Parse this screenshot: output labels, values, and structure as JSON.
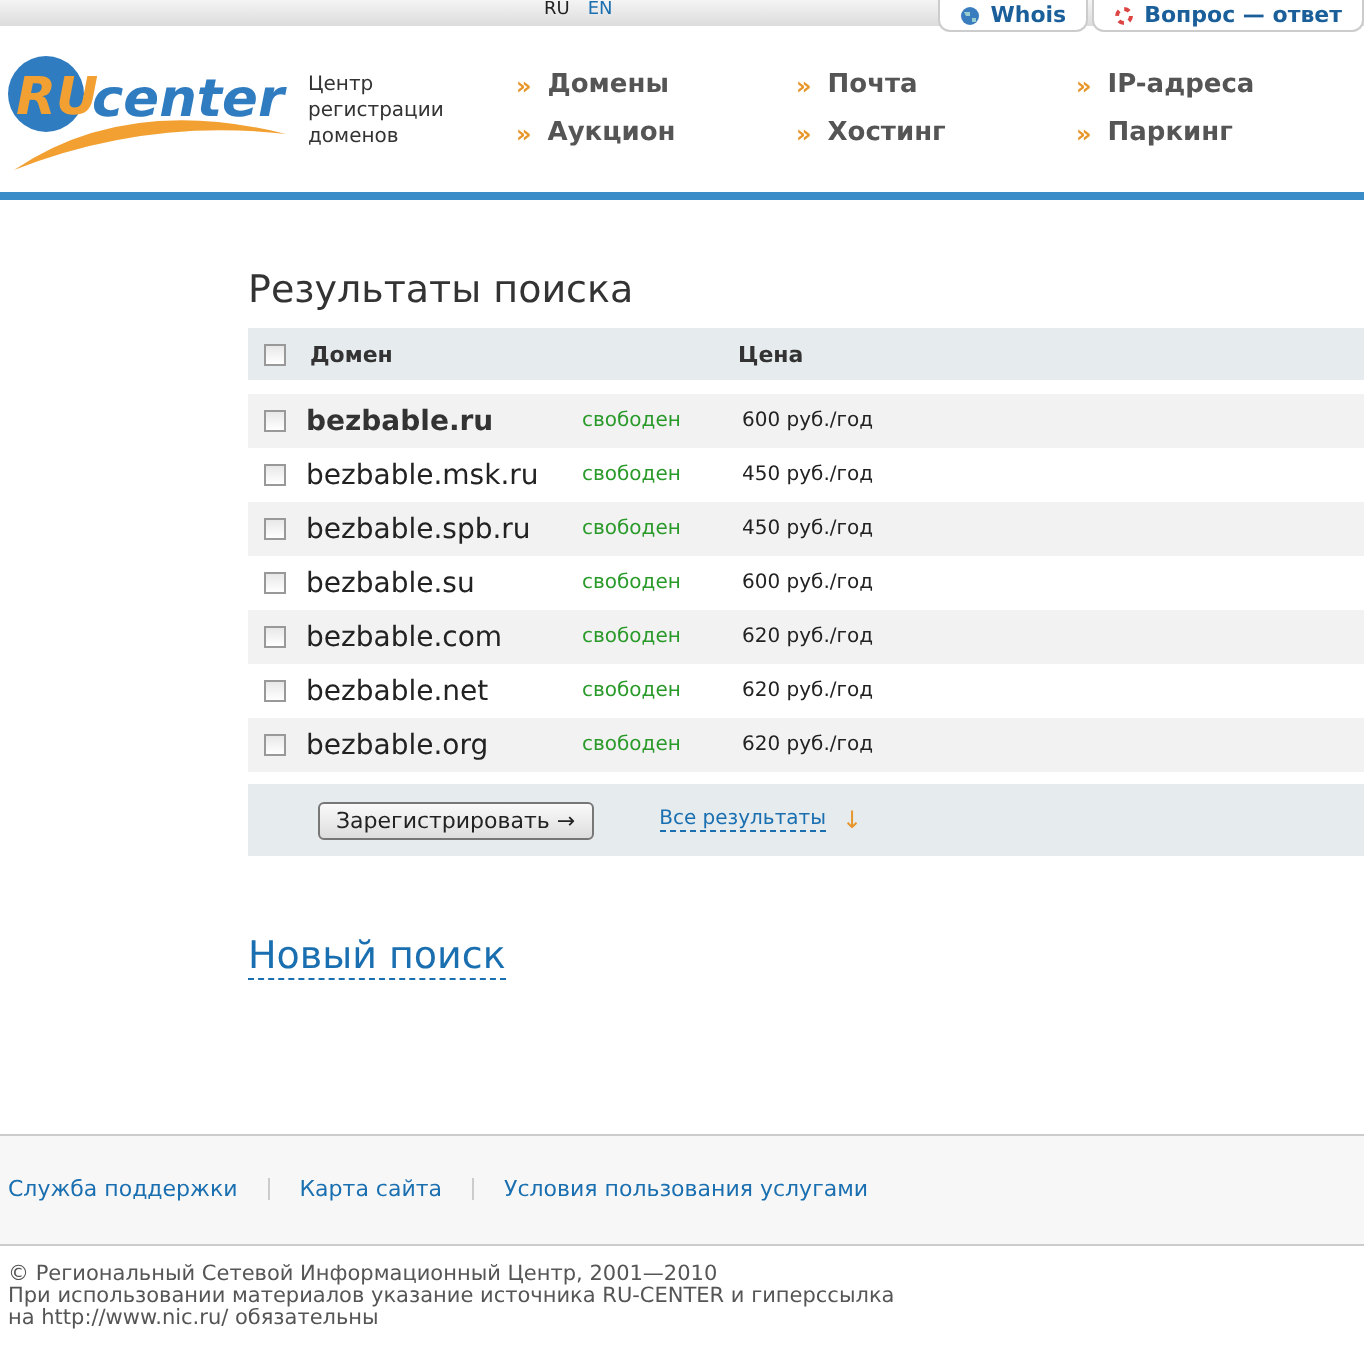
{
  "languages": [
    {
      "label": "RU",
      "selected": true
    },
    {
      "label": "EN",
      "selected": false
    }
  ],
  "top_tabs": [
    "Whois",
    "Вопрос — ответ"
  ],
  "logo": {
    "mark": "RU",
    "word": "center"
  },
  "tagline": [
    "Центр",
    "регистрации",
    "доменов"
  ],
  "nav": [
    {
      "marker": "»",
      "label": "Домены"
    },
    {
      "marker": "»",
      "label": "Почта"
    },
    {
      "marker": "»",
      "label": "IP-адреса"
    },
    {
      "marker": "»",
      "label": "Аукцион"
    },
    {
      "marker": "»",
      "label": "Хостинг"
    },
    {
      "marker": "»",
      "label": "Паркинг"
    }
  ],
  "title": "Результаты поиска",
  "table": {
    "columns": [
      "Домен",
      "Цена"
    ],
    "select_all": false,
    "rows": [
      {
        "domain": "bezbable.ru",
        "emphasized": true,
        "status": "свободен",
        "price": "600 руб./год",
        "checked": false
      },
      {
        "domain": "bezbable.msk.ru",
        "emphasized": false,
        "status": "свободен",
        "price": "450 руб./год",
        "checked": false
      },
      {
        "domain": "bezbable.spb.ru",
        "emphasized": false,
        "status": "свободен",
        "price": "450 руб./год",
        "checked": false
      },
      {
        "domain": "bezbable.su",
        "emphasized": false,
        "status": "свободен",
        "price": "600 руб./год",
        "checked": false
      },
      {
        "domain": "bezbable.com",
        "emphasized": false,
        "status": "свободен",
        "price": "620 руб./год",
        "checked": false
      },
      {
        "domain": "bezbable.net",
        "emphasized": false,
        "status": "свободен",
        "price": "620 руб./год",
        "checked": false
      },
      {
        "domain": "bezbable.org",
        "emphasized": false,
        "status": "свободен",
        "price": "620 руб./год",
        "checked": false
      }
    ]
  },
  "register_button": "Зарегистрировать →",
  "all_results": {
    "label": "Все результаты",
    "arrow": "↓"
  },
  "new_search": "Новый поиск",
  "footer_links": [
    "Служба поддержки",
    "Карта сайта",
    "Условия пользования услугами"
  ],
  "copyright": [
    "© Региональный Сетевой Информационный Центр, 2001—2010",
    "При использовании материалов указание источника RU-CENTER и гиперссылка",
    "на http://www.nic.ru/ обязательны"
  ]
}
